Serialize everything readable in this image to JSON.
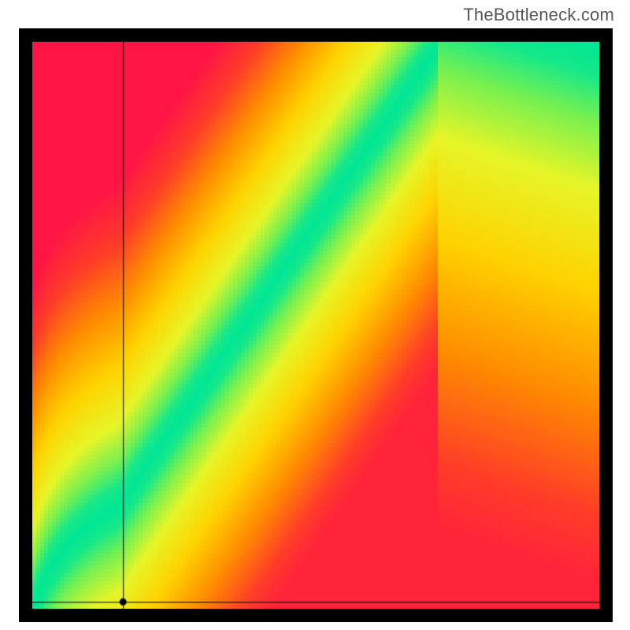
{
  "watermark": "TheBottleneck.com",
  "colors": {
    "black": "#000000",
    "line": "#000000"
  },
  "chart_data": {
    "type": "heatmap",
    "title": "",
    "xlabel": "",
    "ylabel": "",
    "xlim": [
      0,
      100
    ],
    "ylim": [
      0,
      100
    ],
    "resolution": 144,
    "ideal_curve_note": "the green optimum band traces roughly y = 7*ln(1+x/3) for low x then slope≈1.35 diagonal from ~(15,18) to (72,100); points far from the band fall off to yellow/orange/red",
    "band_halfwidth_y": 3.5,
    "crosshair": {
      "x": 16,
      "y": 1.2
    },
    "colormap_stops": [
      {
        "t": 0.0,
        "rgb": [
          0,
          230,
          150
        ]
      },
      {
        "t": 0.1,
        "rgb": [
          120,
          240,
          80
        ]
      },
      {
        "t": 0.22,
        "rgb": [
          230,
          245,
          40
        ]
      },
      {
        "t": 0.4,
        "rgb": [
          255,
          210,
          0
        ]
      },
      {
        "t": 0.6,
        "rgb": [
          255,
          140,
          0
        ]
      },
      {
        "t": 0.8,
        "rgb": [
          255,
          60,
          40
        ]
      },
      {
        "t": 1.0,
        "rgb": [
          255,
          20,
          70
        ]
      }
    ]
  }
}
